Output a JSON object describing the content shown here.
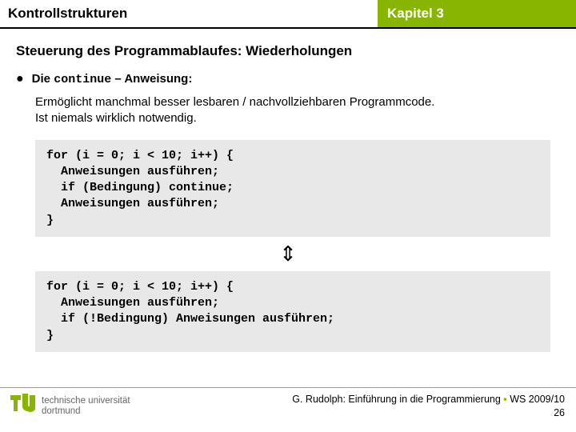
{
  "header": {
    "left": "Kontrollstrukturen",
    "right": "Kapitel 3"
  },
  "section_title": "Steuerung des Programmablaufes: Wiederholungen",
  "bullet": {
    "pre": "Die ",
    "kw": "continue",
    "post": " – Anweisung:"
  },
  "para": "Ermöglicht manchmal besser lesbaren / nachvollziehbaren Programmcode.\nIst niemals wirklich notwendig.",
  "code1": "for (i = 0; i < 10; i++) {\n  Anweisungen ausführen;\n  if (Bedingung) continue;\n  Anweisungen ausführen;\n}",
  "equiv_symbol": "⇕",
  "code2": "for (i = 0; i < 10; i++) {\n  Anweisungen ausführen;\n  if (!Bedingung) Anweisungen ausführen;\n}",
  "footer": {
    "course": "G. Rudolph: Einführung in die Programmierung",
    "term": "WS 2009/10",
    "page": "26",
    "logo_line1": "technische universität",
    "logo_line2": "dortmund"
  }
}
